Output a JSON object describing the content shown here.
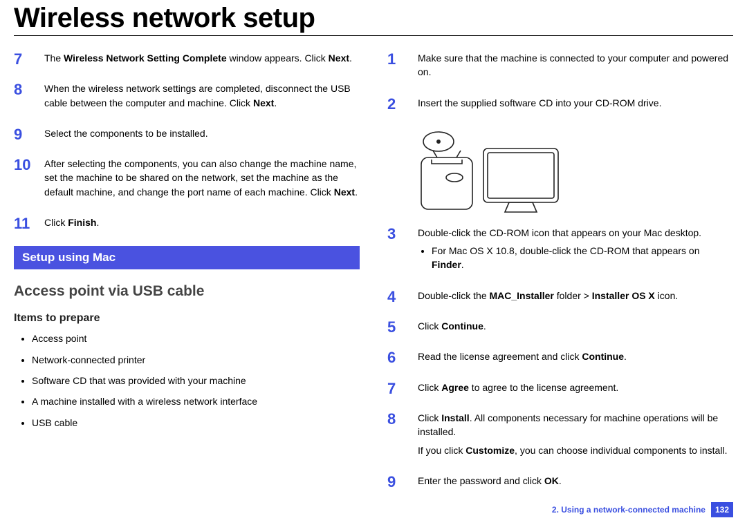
{
  "title": "Wireless network setup",
  "left": {
    "steps": [
      {
        "n": "7",
        "html": "The <b>Wireless Network Setting Complete</b> window appears. Click <b>Next</b>."
      },
      {
        "n": "8",
        "html": "When the wireless network settings are completed, disconnect the USB cable between the computer and machine. Click <b>Next</b>."
      },
      {
        "n": "9",
        "html": "Select the components to be installed."
      },
      {
        "n": "10",
        "html": "After selecting the components, you can also change the machine name, set the machine to be shared on the network, set the machine as the default machine, and change the port name of each machine. Click <b>Next</b>."
      },
      {
        "n": "11",
        "html": "Click <b>Finish</b>."
      }
    ],
    "banner": "Setup using Mac",
    "h2": "Access point via USB cable",
    "h3": "Items to prepare",
    "items": [
      "Access point",
      "Network-connected printer",
      "Software CD that was provided with your machine",
      "A machine installed with a wireless network interface",
      " USB cable"
    ]
  },
  "right": {
    "steps": [
      {
        "n": "1",
        "html": "Make sure that the machine is connected to your computer and powered on."
      },
      {
        "n": "2",
        "html": "Insert the supplied software CD into your CD-ROM drive.",
        "figure": true
      },
      {
        "n": "3",
        "html": "Double-click the CD-ROM icon that appears on your Mac desktop.",
        "sub": [
          "For Mac OS X 10.8, double-click the CD-ROM that appears on <b>Finder</b>."
        ]
      },
      {
        "n": "4",
        "html": "Double-click the <b>MAC_Installer</b> folder &gt; <b>Installer OS X</b> icon."
      },
      {
        "n": "5",
        "html": "Click <b>Continue</b>."
      },
      {
        "n": "6",
        "html": "Read the license agreement and click <b>Continue</b>."
      },
      {
        "n": "7",
        "html": "Click <b>Agree</b> to agree to the license agreement."
      },
      {
        "n": "8",
        "html": "Click <b>Install</b>. All components necessary for machine operations will be installed.",
        "extra": "If you click <b>Customize</b>, you can choose individual components to install."
      },
      {
        "n": "9",
        "html": "Enter the password and click <b>OK</b>."
      }
    ]
  },
  "footer": {
    "chapter": "2.  Using a network-connected machine",
    "page": "132"
  }
}
